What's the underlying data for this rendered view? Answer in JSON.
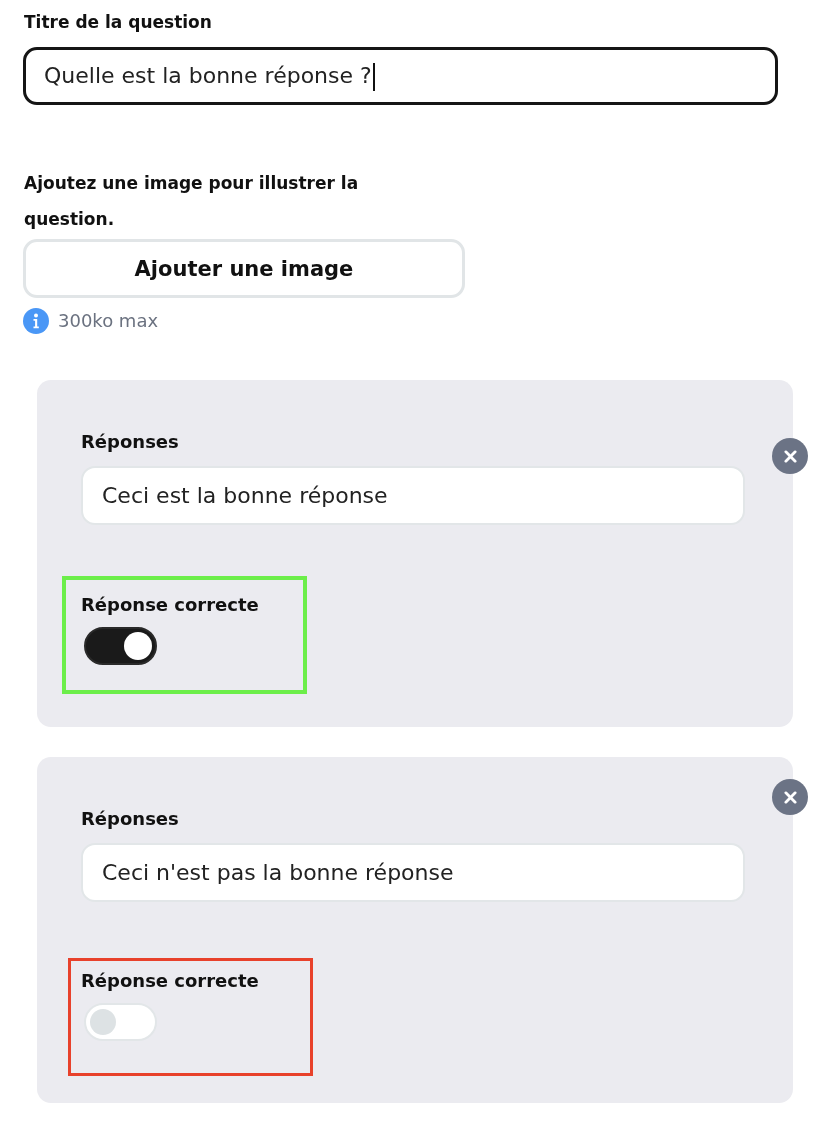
{
  "question_title": {
    "label": "Titre de la question",
    "value": "Quelle est la bonne réponse ?",
    "focused": true
  },
  "image": {
    "label": "Ajoutez une image pour illustrer la question.",
    "button": "Ajouter une image",
    "hint": "300ko max"
  },
  "answers": [
    {
      "label": "Réponses",
      "value": "Ceci est la bonne réponse",
      "correct_label": "Réponse correcte",
      "correct": true,
      "color": "#6cee4a"
    },
    {
      "label": "Réponses",
      "value": "Ceci n'est pas la bonne réponse",
      "correct_label": "Réponse correcte",
      "correct": false,
      "color": "#e8412b"
    }
  ]
}
